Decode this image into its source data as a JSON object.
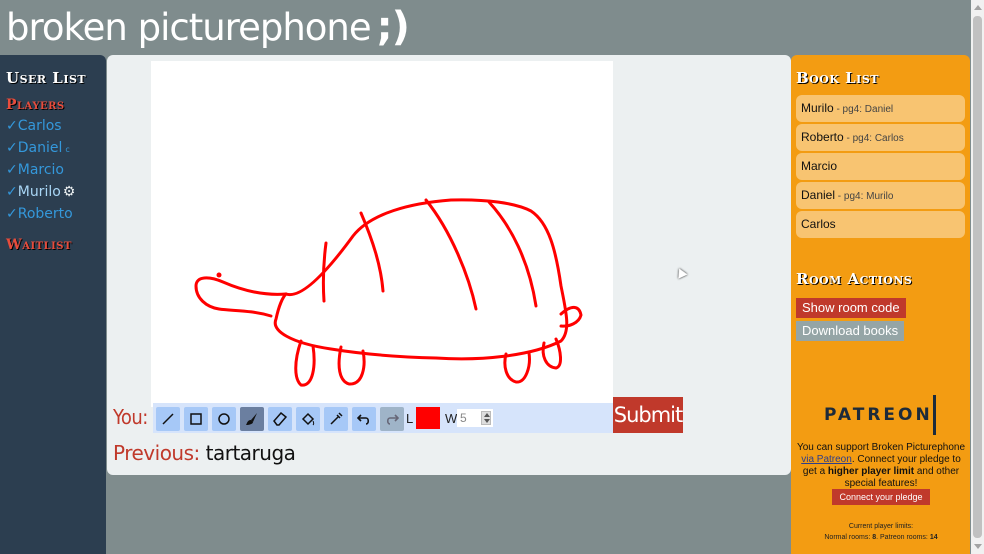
{
  "app": {
    "logo_text": "broken picturephone",
    "logo_smile": ";)"
  },
  "sidebar": {
    "title": "User List",
    "players_title": "Players",
    "players": [
      {
        "check": "✓",
        "name": "Carlos",
        "badge": ""
      },
      {
        "check": "✓",
        "name": "Daniel",
        "badge": "c"
      },
      {
        "check": "✓",
        "name": "Marcio",
        "badge": ""
      },
      {
        "check": "✓",
        "name": "Murilo",
        "badge": "",
        "current": true
      },
      {
        "check": "✓",
        "name": "Roberto",
        "badge": ""
      }
    ],
    "waitlist_title": "Waitlist"
  },
  "drawing": {
    "caption": "null",
    "stroke_color": "#ff0000"
  },
  "toolbar": {
    "you_label": "You:",
    "tools": [
      "line-tool",
      "rectangle-tool",
      "circle-tool",
      "brush-tool",
      "eraser-tool",
      "fill-tool",
      "eyedropper-tool",
      "undo",
      "redo"
    ],
    "active_tool": "brush-tool",
    "color_label": "L",
    "color": "#ff0000",
    "width_label": "W",
    "width_value": "5",
    "submit_label": "Submit"
  },
  "previous": {
    "label": "Previous:",
    "value": "tartaruga"
  },
  "books": {
    "title": "Book List",
    "items": [
      {
        "name": "Murilo",
        "sub": " - pg4: Daniel"
      },
      {
        "name": "Roberto",
        "sub": " - pg4: Carlos"
      },
      {
        "name": "Marcio",
        "sub": ""
      },
      {
        "name": "Daniel",
        "sub": " - pg4: Murilo"
      },
      {
        "name": "Carlos",
        "sub": ""
      }
    ]
  },
  "room_actions": {
    "title": "Room Actions",
    "show_code_label": "Show room code",
    "download_label": "Download books"
  },
  "patreon": {
    "wordmark": "PATREON",
    "text_before": "You can support Broken Picturephone ",
    "link_text": "via Patreon",
    "text_middle": ". Connect your pledge to get a ",
    "bold_text": "higher player limit",
    "text_after": " and other special features!",
    "pledge_button": "Connect your pledge",
    "limits_title": "Current player limits:",
    "normal_label": "Normal rooms: ",
    "normal_value": "8",
    "patreon_label": ". Patreon rooms: ",
    "patreon_value": "14"
  }
}
